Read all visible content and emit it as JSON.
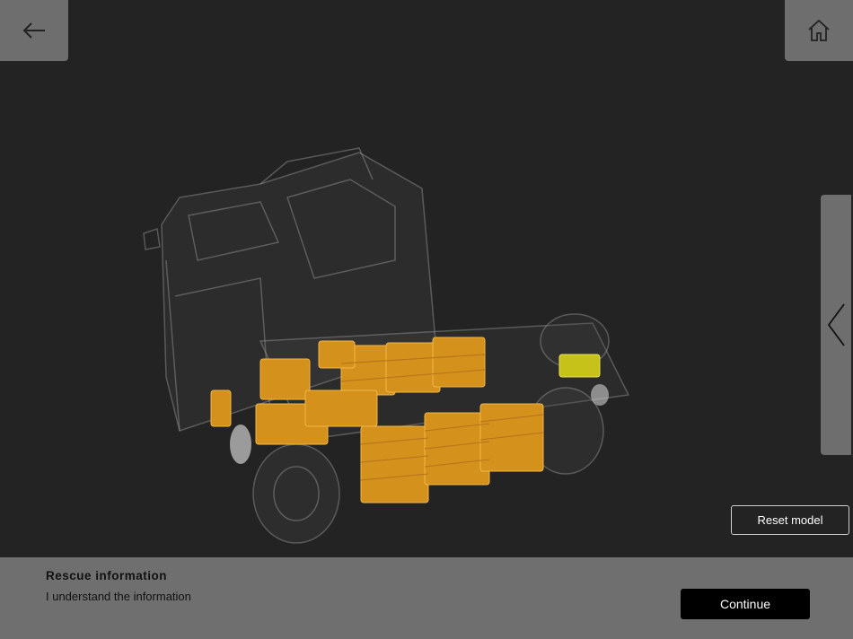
{
  "navigation": {
    "back_icon": "arrow-left-icon",
    "home_icon": "home-icon",
    "side_panel_icon": "chevron-left-icon"
  },
  "viewer": {
    "reset_label": "Reset model"
  },
  "footer": {
    "title": "Rescue information",
    "subtitle": "I understand the information",
    "continue_label": "Continue"
  },
  "colors": {
    "background": "#232323",
    "panel": "#6f6f6f",
    "battery": "#d4911c",
    "highlight": "#c7c21a"
  }
}
